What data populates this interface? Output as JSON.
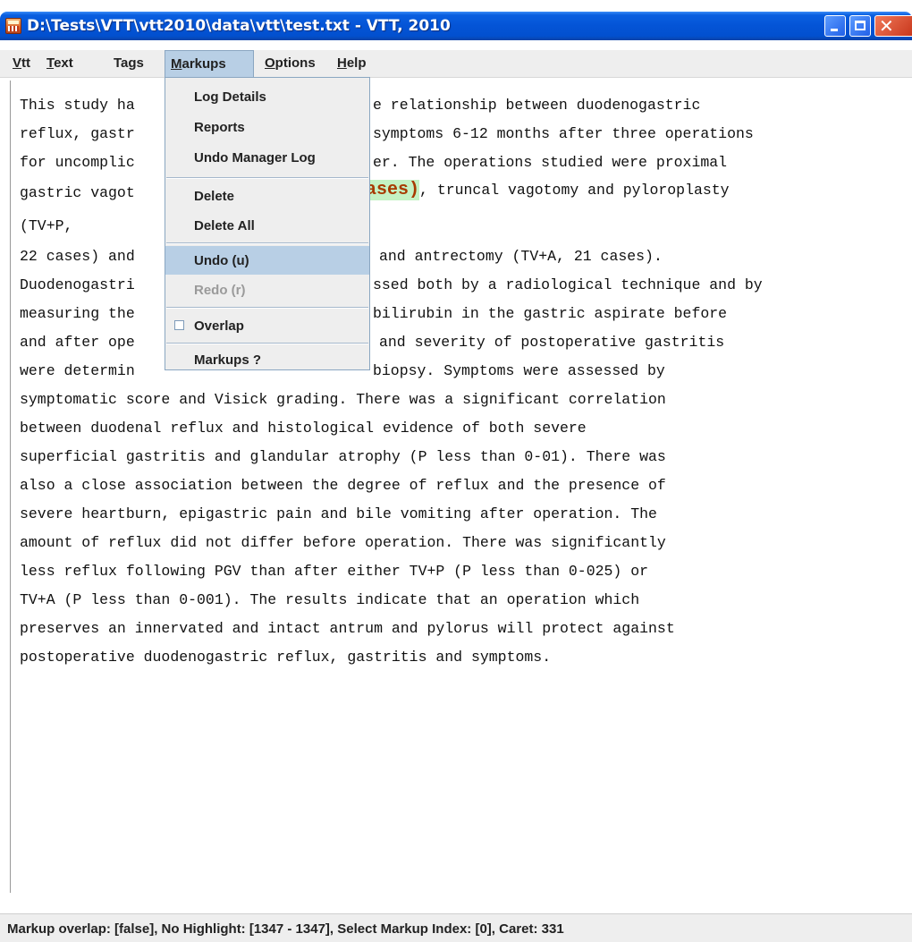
{
  "window": {
    "title": "D:\\Tests\\VTT\\vtt2010\\data\\vtt\\test.txt - VTT, 2010",
    "close_glyph": "✕",
    "icons": [
      "app-icon",
      "minimize-icon",
      "maximize-icon",
      "close-icon"
    ]
  },
  "menubar": {
    "items": [
      {
        "label": "Vtt",
        "mnemonic": "V",
        "rest": "tt"
      },
      {
        "label": "Text",
        "mnemonic": "T",
        "rest": "ext"
      },
      {
        "label": "Tags",
        "mnemonic": "",
        "rest": "Tags"
      },
      {
        "label": "Markups",
        "mnemonic": "M",
        "rest": "arkups"
      },
      {
        "label": "Options",
        "mnemonic": "O",
        "rest": "ptions"
      },
      {
        "label": "Help",
        "mnemonic": "H",
        "rest": "elp"
      }
    ],
    "active_menu": "Markups"
  },
  "markups_menu": {
    "items": [
      {
        "label": "Log Details"
      },
      {
        "label": "Reports"
      },
      {
        "label": "Undo Manager Log"
      },
      {
        "label": "Delete"
      },
      {
        "label": "Delete All"
      },
      {
        "label": "Undo (u)",
        "state": "hover"
      },
      {
        "label": "Redo (r)",
        "state": "disabled"
      },
      {
        "label": "Overlap",
        "checked": false
      },
      {
        "label": "Markups ?"
      }
    ]
  },
  "document": {
    "lines": [
      {
        "text": "This study ha",
        "rest": "e relationship between duodenogastric"
      },
      {
        "text": "reflux, gastr",
        "rest": "symptoms 6-12 months after three operations"
      },
      {
        "text": "for uncomplic",
        "rest": "er. The operations studied were proximal"
      },
      {
        "text": "gastric vagot",
        "highlight": "ases)",
        "rest": ", truncal vagotomy and pyloroplasty"
      },
      {
        "text": "(TV+P,"
      },
      {
        "text": "22 cases) and",
        "rest": "and antrectomy (TV+A, 21 cases)."
      },
      {
        "text": "Duodenogastri",
        "rest": "ssed both by a radiological technique and by"
      },
      {
        "text": "measuring the",
        "rest": "bilirubin in the gastric aspirate before"
      },
      {
        "text": "and after ope",
        "rest": "and severity of postoperative gastritis"
      },
      {
        "text": "were determin",
        "rest": "biopsy. Symptoms were assessed by"
      },
      {
        "text": "symptomatic score and Visick grading. There was a significant correlation"
      },
      {
        "text": "between duodenal reflux and histological evidence of both severe"
      },
      {
        "text": "superficial gastritis and glandular atrophy (P less than 0-01). There was"
      },
      {
        "text": "also a close association between the degree of reflux and the presence of"
      },
      {
        "text": "severe heartburn, epigastric pain and bile vomiting after operation. The"
      },
      {
        "text": "amount of reflux did not differ before operation. There was significantly"
      },
      {
        "text": "less reflux following PGV than after either TV+P (P less than 0-025) or"
      },
      {
        "text": "TV+A (P less than 0-001). The results indicate that an operation which"
      },
      {
        "text": "preserves an innervated and intact antrum and pylorus will protect against"
      },
      {
        "text": "postoperative duodenogastric reflux, gastritis and symptoms."
      }
    ]
  },
  "statusbar": {
    "text": "Markup overlap: [false], No Highlight: [1347 - 1347], Select Markup Index: [0], Caret: 331"
  }
}
